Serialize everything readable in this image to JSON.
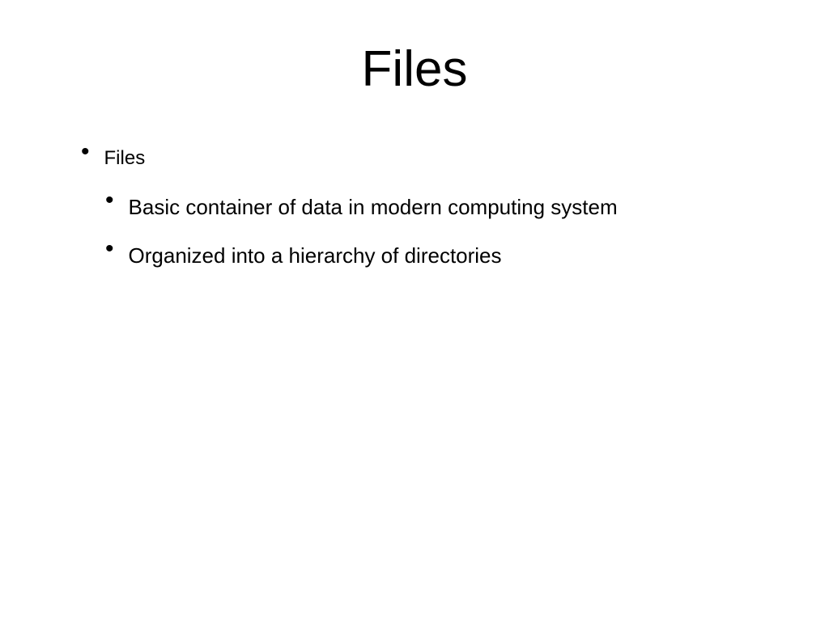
{
  "slide": {
    "title": "Files",
    "bullets": [
      {
        "text": "Files",
        "children": [
          {
            "text": "Basic container of data in modern computing system"
          },
          {
            "text": "Organized into a hierarchy of directories"
          }
        ]
      }
    ]
  }
}
